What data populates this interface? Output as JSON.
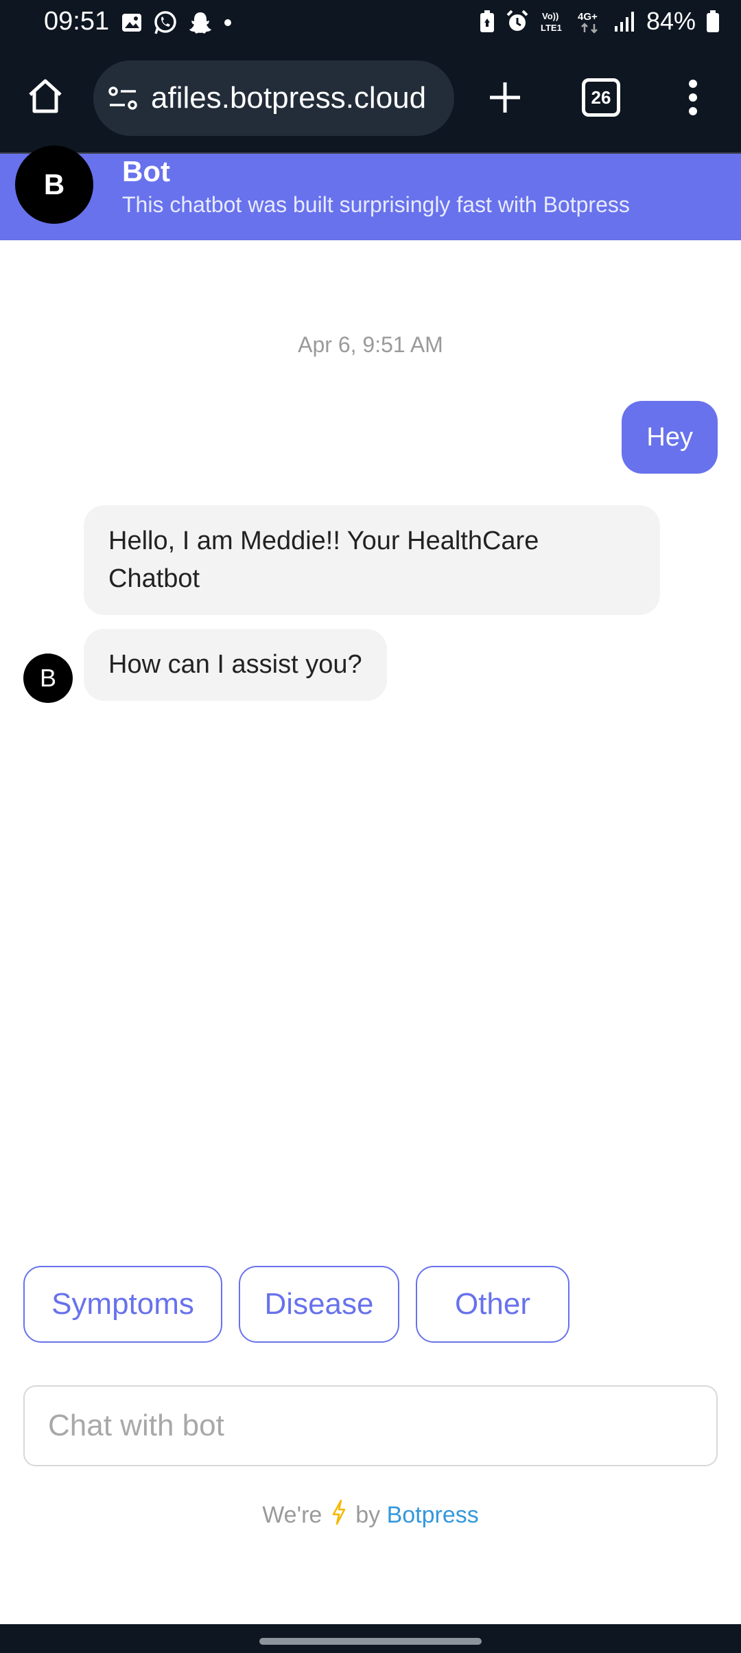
{
  "status_bar": {
    "time": "09:51",
    "network_label": "4G+",
    "lte_label": "LTE1",
    "battery": "84%",
    "left_icons": [
      "gallery-icon",
      "whatsapp-icon",
      "snapchat-icon",
      "dot-icon"
    ],
    "right_icons": [
      "battery-saver-icon",
      "alarm-icon",
      "volte-icon",
      "signal-icon",
      "battery-icon"
    ]
  },
  "browser": {
    "url": "afiles.botpress.cloud",
    "tab_count": "26"
  },
  "chat": {
    "header": {
      "avatar_letter": "B",
      "title": "Bot",
      "subtitle": "This chatbot was built surprisingly fast with Botpress"
    },
    "timestamp": "Apr 6, 9:51 AM",
    "messages": [
      {
        "from": "user",
        "text": "Hey"
      },
      {
        "from": "bot",
        "text": "Hello, I am Meddie!! Your HealthCare Chatbot"
      },
      {
        "from": "bot",
        "text": "How can I assist you?"
      }
    ],
    "bot_avatar_letter": "B",
    "quick_replies": [
      "Symptoms",
      "Disease",
      "Other"
    ],
    "input_placeholder": "Chat with bot",
    "footer": {
      "prefix": "We're",
      "middle": "by",
      "brand": "Botpress"
    }
  },
  "colors": {
    "accent": "#6872ec",
    "status_bg": "#0e1621",
    "bubble_bg": "#f3f3f3",
    "link": "#3498db",
    "bolt": "#f5b800"
  }
}
